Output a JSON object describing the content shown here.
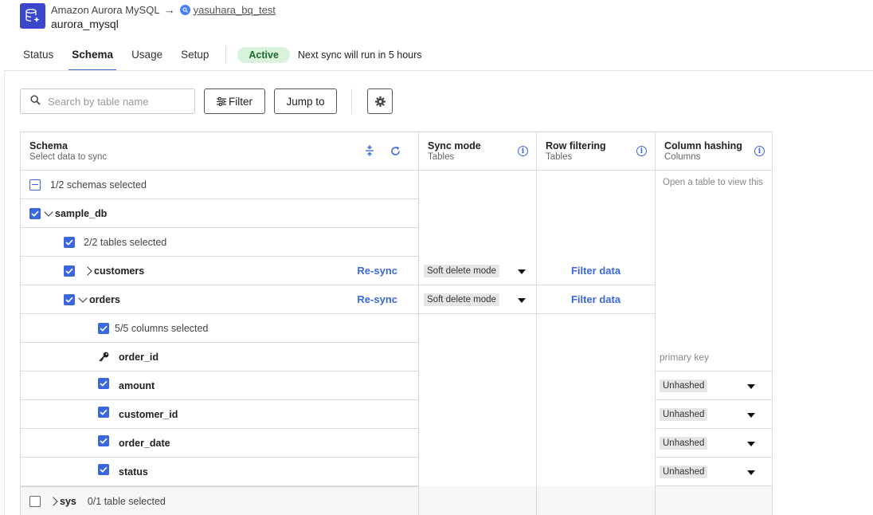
{
  "header": {
    "source_name": "Amazon Aurora MySQL",
    "destination_name": "yasuhara_bq_test",
    "connector_name": "aurora_mysql"
  },
  "tabs": [
    {
      "label": "Status"
    },
    {
      "label": "Schema"
    },
    {
      "label": "Usage"
    },
    {
      "label": "Setup"
    }
  ],
  "status": {
    "badge": "Active",
    "next_sync": "Next sync will run in 5 hours"
  },
  "toolbar": {
    "search_placeholder": "Search by table name",
    "filter_label": "Filter",
    "jump_label": "Jump to"
  },
  "columns": {
    "schema": {
      "title": "Schema",
      "subtitle": "Select data to sync"
    },
    "sync_mode": {
      "title": "Sync mode",
      "subtitle": "Tables"
    },
    "row_filtering": {
      "title": "Row filtering",
      "subtitle": "Tables"
    },
    "column_hashing": {
      "title": "Column hashing",
      "subtitle": "Columns"
    }
  },
  "schema_summary": "1/2 schemas selected",
  "hashing_hint": "Open a table to view this",
  "sample_db": {
    "name": "sample_db",
    "tables_selected": "2/2 tables selected",
    "tables": [
      {
        "name": "customers",
        "resync": "Re-sync",
        "sync_mode": "Soft delete mode",
        "filter": "Filter data"
      },
      {
        "name": "orders",
        "resync": "Re-sync",
        "sync_mode": "Soft delete mode",
        "filter": "Filter data"
      }
    ],
    "columns_selected": "5/5 columns selected",
    "columns": [
      {
        "name": "order_id",
        "hash": "primary key"
      },
      {
        "name": "amount",
        "hash": "Unhashed"
      },
      {
        "name": "customer_id",
        "hash": "Unhashed"
      },
      {
        "name": "order_date",
        "hash": "Unhashed"
      },
      {
        "name": "status",
        "hash": "Unhashed"
      }
    ]
  },
  "sys": {
    "name": "sys",
    "tables_selected": "0/1 table selected"
  },
  "colors": {
    "accent": "#3a66e0",
    "active_bg": "#d8f2dc",
    "active_text": "#1e6b32"
  }
}
